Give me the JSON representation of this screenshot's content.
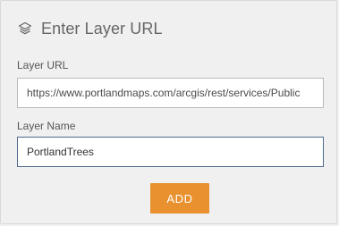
{
  "header": {
    "title": "Enter Layer URL",
    "icon": "layers-icon"
  },
  "form": {
    "url_label": "Layer URL",
    "url_value": "https://www.portlandmaps.com/arcgis/rest/services/Public",
    "name_label": "Layer Name",
    "name_value": "PortlandTrees"
  },
  "actions": {
    "add_label": "ADD"
  },
  "colors": {
    "background": "#f0f0f0",
    "accent": "#e8912e",
    "focus_border": "#4e6a8c"
  }
}
